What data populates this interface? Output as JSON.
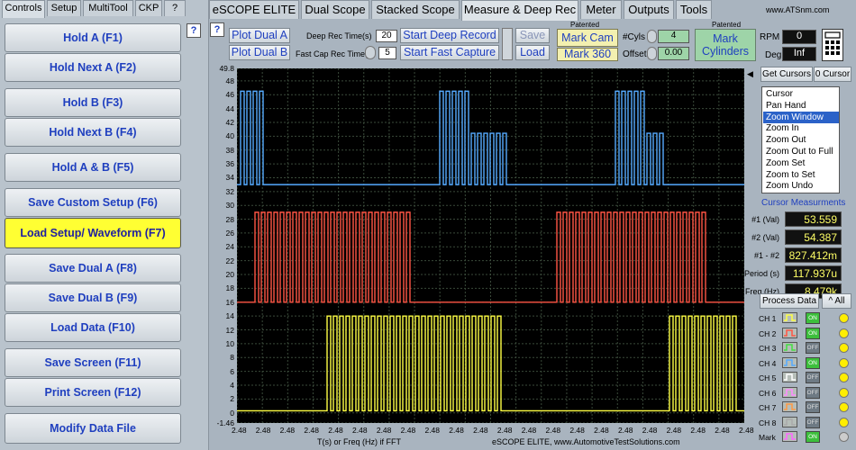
{
  "left_tabs": [
    "Controls",
    "Setup",
    "MultiTool",
    "CKP",
    "?"
  ],
  "left_buttons": [
    "Hold A (F1)",
    "Hold Next A (F2)",
    "Hold B (F3)",
    "Hold Next B (F4)",
    "Hold A & B (F5)",
    "Save Custom Setup (F6)",
    "Load Setup/ Waveform (F7)",
    "Save Dual A (F8)",
    "Save Dual B (F9)",
    "Load Data (F10)",
    "Save Screen (F11)",
    "Print Screen (F12)",
    "Modify Data File"
  ],
  "help_label": "?",
  "top_tabs": [
    "eSCOPE ELITE",
    "Dual Scope",
    "Stacked Scope",
    "Measure & Deep Rec",
    "Meter",
    "Outputs",
    "Tools"
  ],
  "website": "www.ATSnm.com",
  "toolbar": {
    "plot_dual_a": "Plot Dual A",
    "plot_dual_b": "Plot Dual B",
    "deep_rec_time_label": "Deep Rec Time(s)",
    "deep_rec_time_value": "20",
    "fast_cap_rec_label": "Fast Cap Rec Time(s)",
    "fast_cap_rec_value": "5",
    "start_deep_record": "Start Deep Record",
    "start_fast_capture": "Start Fast Capture",
    "save": "Save",
    "load": "Load",
    "patented_1": "Patented",
    "mark_cam": "Mark Cam",
    "mark_360": "Mark 360",
    "cyls_label": "#Cyls",
    "cyls_value": "4",
    "offset_label": "Offset",
    "offset_value": "0.00",
    "patented_2": "Patented",
    "mark_cylinders": "Mark Cylinders",
    "rpm_label": "RPM",
    "rpm_value": "0",
    "deg_label": "Deg",
    "deg_value": "Inf"
  },
  "cursor_controls": {
    "get_cursors": "Get Cursors",
    "zero_cursor": "0 Cursor",
    "menu": [
      "Cursor",
      "Pan Hand",
      "Zoom Window",
      "Zoom In",
      "Zoom Out",
      "Zoom Out to Full",
      "Zoom Set",
      "Zoom to Set",
      "Zoom Undo"
    ],
    "selected": "Zoom Window"
  },
  "measurements": {
    "title": "Cursor Measurments",
    "rows": [
      {
        "label": "#1 (Val)",
        "value": "53.559"
      },
      {
        "label": "#2 (Val)",
        "value": "54.387"
      },
      {
        "label": "#1 - #2",
        "value": "827.412m"
      },
      {
        "label": "Period (s)",
        "value": "117.937u"
      },
      {
        "label": "Freq (Hz)",
        "value": "8.479k"
      }
    ]
  },
  "process_data": "Process Data",
  "all_label": "^ All",
  "channels": [
    {
      "label": "CH 1",
      "state": "ON",
      "color": "#ffff44"
    },
    {
      "label": "CH 2",
      "state": "ON",
      "color": "#ff5544"
    },
    {
      "label": "CH 3",
      "state": "OFF",
      "color": "#44dd44"
    },
    {
      "label": "CH 4",
      "state": "ON",
      "color": "#55aaff"
    },
    {
      "label": "CH 5",
      "state": "OFF",
      "color": "#ffffff"
    },
    {
      "label": "CH 6",
      "state": "OFF",
      "color": "#ff88ff"
    },
    {
      "label": "CH 7",
      "state": "OFF",
      "color": "#ff9944"
    },
    {
      "label": "CH 8",
      "state": "OFF",
      "color": "#aaaaaa"
    },
    {
      "label": "Mark",
      "state": "ON",
      "color": "#ff66ff"
    }
  ],
  "chart_data": {
    "type": "line",
    "y_ticks": [
      "49.8",
      "48",
      "46",
      "44",
      "42",
      "40",
      "38",
      "36",
      "34",
      "32",
      "30",
      "28",
      "26",
      "24",
      "22",
      "20",
      "18",
      "16",
      "14",
      "12",
      "10",
      "8",
      "6",
      "4",
      "2",
      "0",
      "-1.46"
    ],
    "x_ticks": [
      "2.48",
      "2.48",
      "2.48",
      "2.48",
      "2.48",
      "2.48",
      "2.48",
      "2.48",
      "2.48",
      "2.48",
      "2.48",
      "2.48",
      "2.48",
      "2.48",
      "2.48",
      "2.48",
      "2.48",
      "2.48",
      "2.48",
      "2.48",
      "2.48",
      "2.48"
    ],
    "xlabel": "T(s) or Freq (Hz) if FFT",
    "footer": "eSCOPE ELITE, www.AutomotiveTestSolutions.com",
    "ylim": [
      -1.46,
      49.8
    ],
    "grid": true,
    "series": [
      {
        "color": "#55aaff",
        "baseline": 33,
        "high": 46.5
      },
      {
        "color": "#ff5544",
        "baseline": 16,
        "high": 29
      },
      {
        "color": "#ffff44",
        "baseline": 0.3,
        "high": 14
      }
    ]
  }
}
